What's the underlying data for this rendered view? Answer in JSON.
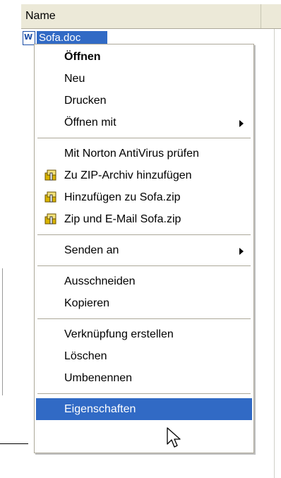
{
  "header": {
    "name_col": "Name"
  },
  "file": {
    "name": "Sofa.doc",
    "icon": "word-document-icon"
  },
  "menu": {
    "items": [
      {
        "label": "Öffnen"
      },
      {
        "label": "Neu"
      },
      {
        "label": "Drucken"
      },
      {
        "label": "Öffnen mit"
      },
      {
        "label": "Mit Norton AntiVirus prüfen"
      },
      {
        "label": "Zu ZIP-Archiv hinzufügen",
        "icon": "winzip-icon"
      },
      {
        "label": "Hinzufügen zu Sofa.zip",
        "icon": "winzip-icon"
      },
      {
        "label": "Zip und E-Mail Sofa.zip",
        "icon": "winzip-icon"
      },
      {
        "label": "Senden an"
      },
      {
        "label": "Ausschneiden"
      },
      {
        "label": "Kopieren"
      },
      {
        "label": "Verknüpfung erstellen"
      },
      {
        "label": "Löschen"
      },
      {
        "label": "Umbenennen"
      },
      {
        "label": "Eigenschaften"
      }
    ]
  },
  "colors": {
    "selection": "#316ac5",
    "menu_border": "#aca899",
    "header_bg": "#ece9d8"
  }
}
